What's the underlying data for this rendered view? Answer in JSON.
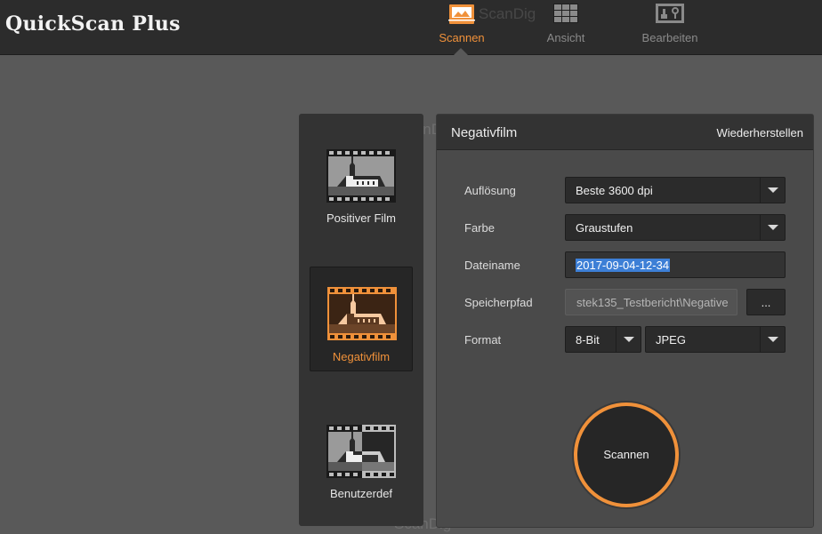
{
  "app": {
    "title": "QuickScan Plus",
    "watermark": "ScanDig"
  },
  "nav": {
    "tabs": [
      {
        "label": "Scannen",
        "icon": "scanner-icon",
        "active": true
      },
      {
        "label": "Ansicht",
        "icon": "grid-view-icon",
        "active": false
      },
      {
        "label": "Bearbeiten",
        "icon": "edit-tools-icon",
        "active": false
      }
    ]
  },
  "film_types": [
    {
      "label": "Positiver Film",
      "icon": "positive-film-icon",
      "selected": false
    },
    {
      "label": "Negativfilm",
      "icon": "negative-film-icon",
      "selected": true
    },
    {
      "label": "Benutzerdef",
      "icon": "custom-film-icon",
      "selected": false
    }
  ],
  "panel": {
    "title": "Negativfilm",
    "restore_label": "Wiederherstellen",
    "resolution": {
      "label": "Auflösung",
      "value": "Beste 3600 dpi"
    },
    "color": {
      "label": "Farbe",
      "value": "Graustufen"
    },
    "filename": {
      "label": "Dateiname",
      "value": "2017-09-04-12-34"
    },
    "path": {
      "label": "Speicherpfad",
      "value": "stek135_Testbericht\\Negative",
      "browse_label": "..."
    },
    "format": {
      "label": "Format",
      "bitdepth": "8-Bit",
      "filetype": "JPEG"
    },
    "scan_label": "Scannen"
  },
  "colors": {
    "accent": "#f0913a",
    "background": "#595959",
    "topbar": "#2c2c2c",
    "selection": "#3d7fd6"
  }
}
